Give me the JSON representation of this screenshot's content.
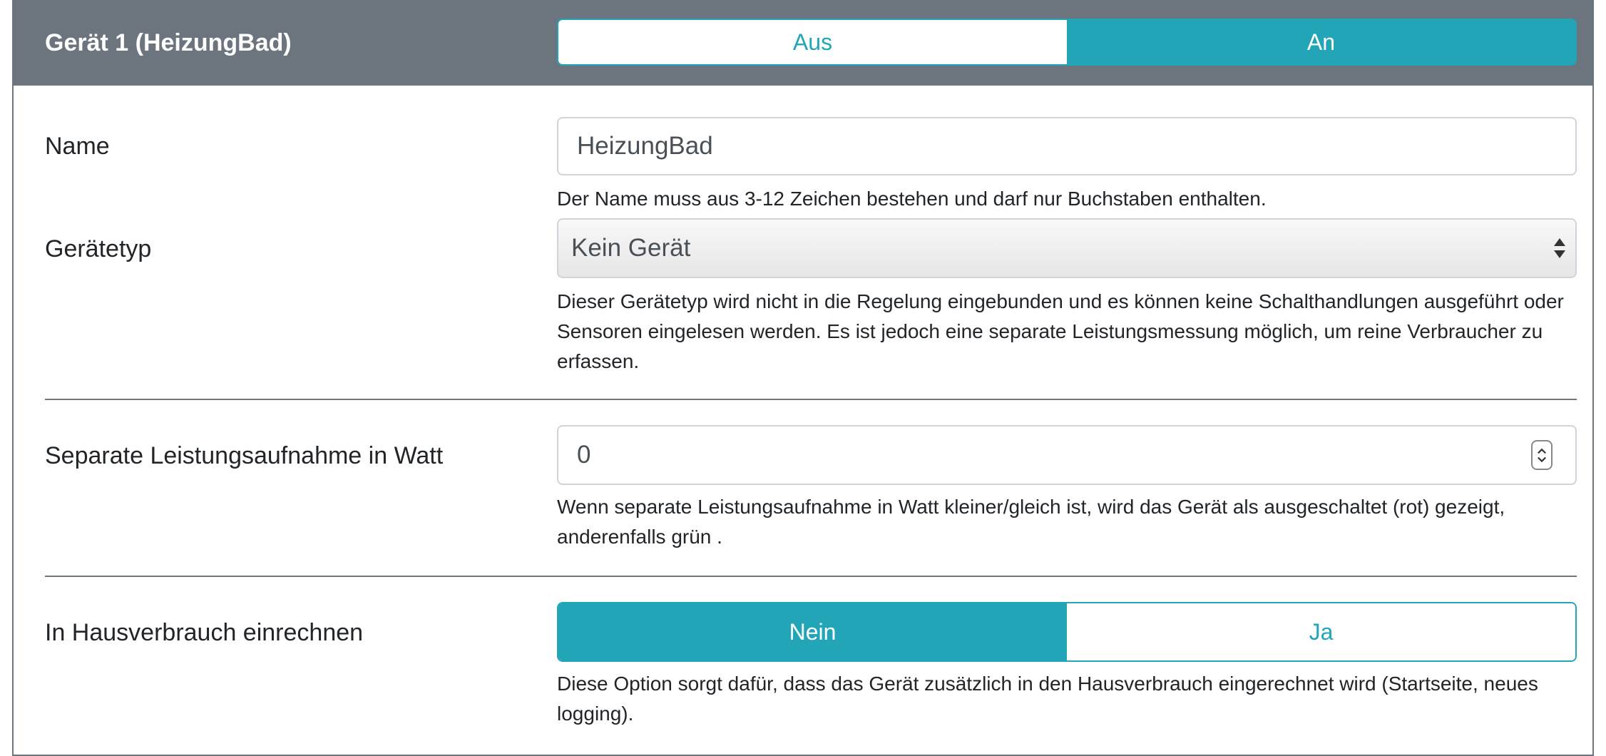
{
  "header": {
    "title": "Gerät 1 (HeizungBad)",
    "state_toggle": {
      "off_label": "Aus",
      "on_label": "An",
      "selected": "An"
    }
  },
  "name_field": {
    "label": "Name",
    "value": "HeizungBad",
    "help": "Der Name muss aus 3-12 Zeichen bestehen und darf nur Buchstaben enthalten."
  },
  "device_type": {
    "label": "Gerätetyp",
    "selected": "Kein Gerät",
    "help": "Dieser Gerätetyp wird nicht in die Regelung eingebunden und es können keine Schalthandlungen ausgeführt oder Sensoren eingelesen werden. Es ist jedoch eine separate Leistungsmessung möglich, um reine Verbraucher zu erfassen."
  },
  "power": {
    "label": "Separate Leistungsaufnahme in Watt",
    "value": "0",
    "help": "Wenn separate Leistungsaufnahme in Watt kleiner/gleich ist, wird das Gerät als ausgeschaltet (rot) gezeigt, anderenfalls grün ."
  },
  "house_consumption": {
    "label": "In Hausverbrauch einrechnen",
    "no_label": "Nein",
    "yes_label": "Ja",
    "selected": "Nein",
    "help": "Diese Option sorgt dafür, dass das Gerät zusätzlich in den Hausverbrauch eingerechnet wird (Startseite, neues logging)."
  },
  "colors": {
    "accent": "#23a5b8",
    "header_bg": "#6c757d"
  }
}
